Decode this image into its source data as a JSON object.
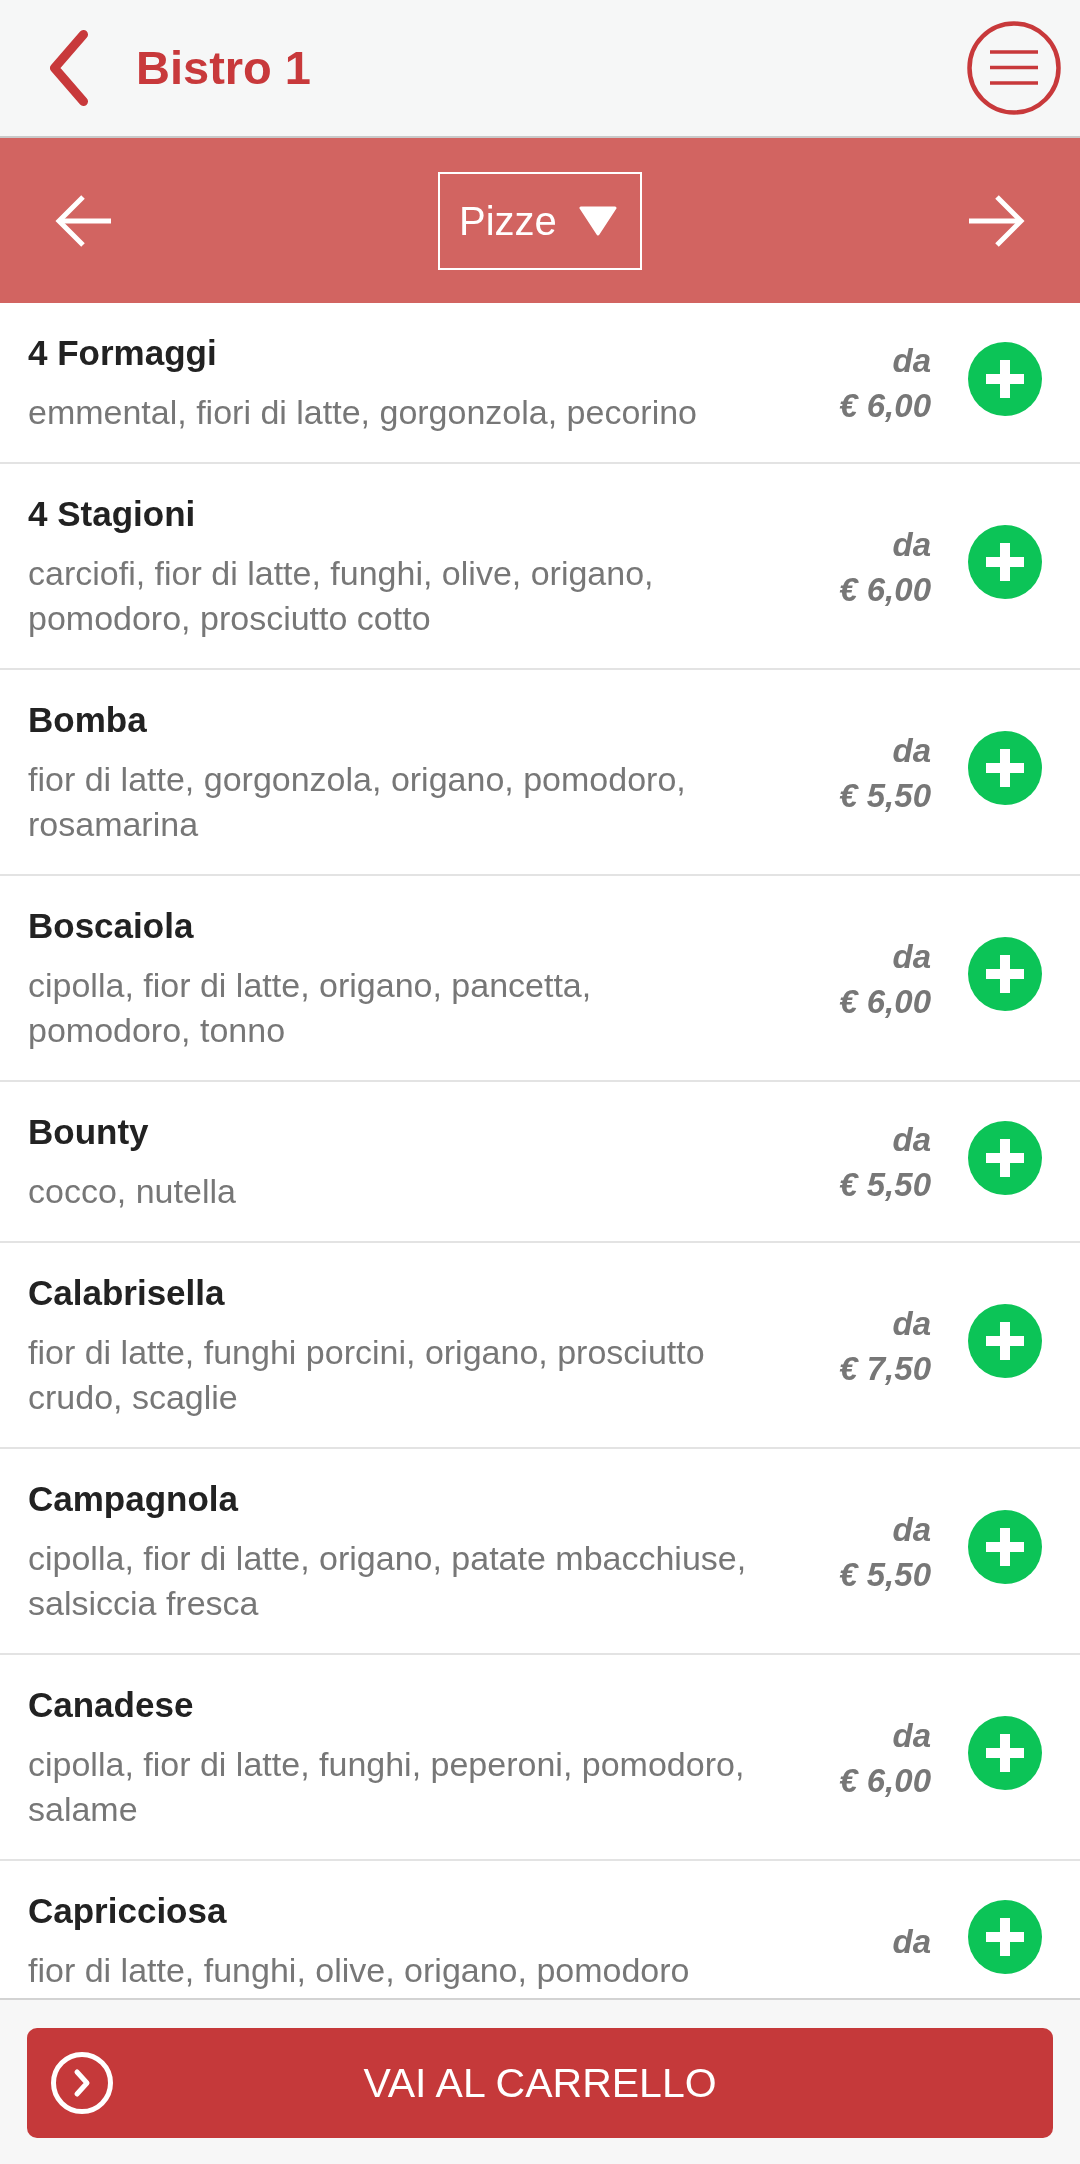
{
  "header": {
    "title": "Bistro 1"
  },
  "category_bar": {
    "category": "Pizze"
  },
  "items": [
    {
      "name": "4 Formaggi",
      "description": "emmental, fiori di latte, gorgonzola, pecorino",
      "price_prefix": "da",
      "price": "€ 6,00"
    },
    {
      "name": "4 Stagioni",
      "description": "carciofi, fior di latte, funghi, olive, origano, pomodoro, prosciutto cotto",
      "price_prefix": "da",
      "price": "€ 6,00"
    },
    {
      "name": "Bomba",
      "description": "fior di latte, gorgonzola, origano, pomodoro, rosamarina",
      "price_prefix": "da",
      "price": "€ 5,50"
    },
    {
      "name": "Boscaiola",
      "description": "cipolla, fior di latte, origano, pancetta, pomodoro, tonno",
      "price_prefix": "da",
      "price": "€ 6,00"
    },
    {
      "name": "Bounty",
      "description": "cocco, nutella",
      "price_prefix": "da",
      "price": "€ 5,50"
    },
    {
      "name": "Calabrisella",
      "description": "fior di latte, funghi porcini, origano, prosciutto crudo, scaglie",
      "price_prefix": "da",
      "price": "€ 7,50"
    },
    {
      "name": "Campagnola",
      "description": "cipolla, fior di latte, origano, patate mbacchiuse, salsiccia fresca",
      "price_prefix": "da",
      "price": "€ 5,50"
    },
    {
      "name": "Canadese",
      "description": "cipolla, fior di latte, funghi, peperoni, pomodoro, salame",
      "price_prefix": "da",
      "price": "€ 6,00"
    },
    {
      "name": "Capricciosa",
      "description": "fior di latte, funghi, olive, origano, pomodoro",
      "price_prefix": "da"
    }
  ],
  "cart_button": {
    "label": "VAI AL CARRELLO"
  }
}
